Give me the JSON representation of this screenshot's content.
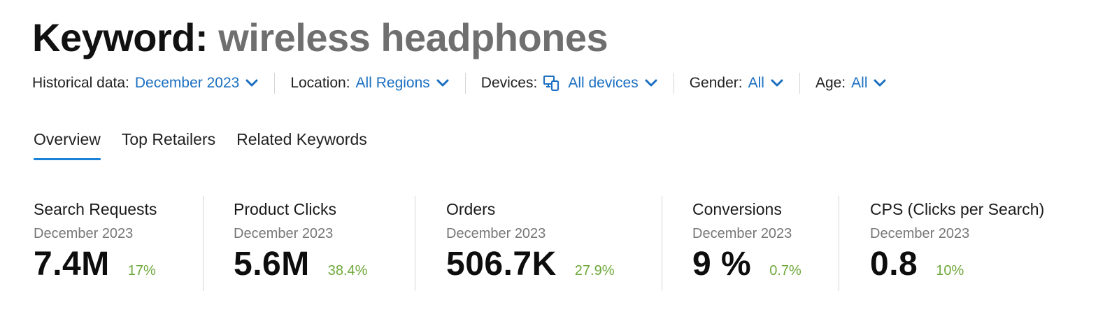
{
  "title": {
    "prefix": "Keyword:",
    "keyword": "wireless headphones"
  },
  "filters": [
    {
      "label": "Historical data:",
      "value": "December 2023",
      "icon": null
    },
    {
      "label": "Location:",
      "value": "All Regions",
      "icon": null
    },
    {
      "label": "Devices:",
      "value": "All devices",
      "icon": "devices-icon"
    },
    {
      "label": "Gender:",
      "value": "All",
      "icon": null
    },
    {
      "label": "Age:",
      "value": "All",
      "icon": null
    }
  ],
  "tabs": [
    {
      "label": "Overview",
      "active": true
    },
    {
      "label": "Top Retailers",
      "active": false
    },
    {
      "label": "Related Keywords",
      "active": false
    }
  ],
  "metrics": [
    {
      "title": "Search Requests",
      "period": "December 2023",
      "value": "7.4M",
      "change": "17%"
    },
    {
      "title": "Product Clicks",
      "period": "December 2023",
      "value": "5.6M",
      "change": "38.4%"
    },
    {
      "title": "Orders",
      "period": "December 2023",
      "value": "506.7K",
      "change": "27.9%"
    },
    {
      "title": "Conversions",
      "period": "December 2023",
      "value": "9 %",
      "change": "0.7%"
    },
    {
      "title": "CPS (Clicks per Search)",
      "period": "December 2023",
      "value": "0.8",
      "change": "10%"
    }
  ],
  "colors": {
    "accent": "#1b6fc1",
    "tab_underline": "#1a83d8",
    "positive_change": "#6ea83a",
    "muted_text": "#777777",
    "keyword_gray": "#6f6f6f"
  }
}
